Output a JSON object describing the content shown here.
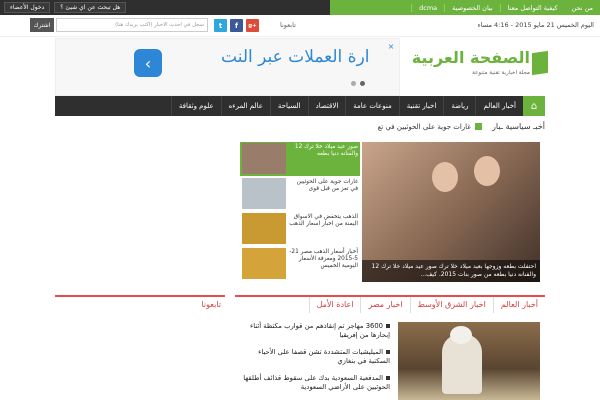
{
  "topbar": {
    "links": [
      "من نحن",
      "كيفية التواصل معنا",
      "بيان الخصوصية",
      "dcma"
    ],
    "search_question": "هل تبحث عن اي شيئ ؟",
    "login": "دخول الأعضاء"
  },
  "datestrip": {
    "date": "اليوم الخميس 21 مايو 2015 - 4:16 مساء",
    "follow_label": "تابعونا",
    "newsletter_placeholder": "سجل في احدث الاخبار (اكتب بريدك هنا)",
    "subscribe_label": "اشترك"
  },
  "social": {
    "twitter": "t",
    "facebook": "f",
    "googleplus": "g+"
  },
  "ad": {
    "text": "ارة العملات عبر النت",
    "close": "×",
    "next": "‹"
  },
  "logo": {
    "name": "الصفحة العربية",
    "tagline": "مجلة اخبارية تقنية متنوعة"
  },
  "nav": {
    "home_icon": "home-icon",
    "items": [
      "أخبار العالم",
      "رياضة",
      "اخبار تقنية",
      "منوعات عامة",
      "الاقتصاد",
      "السياحة",
      "عالم المرءه",
      "علوم وثقافة"
    ]
  },
  "ticker": {
    "title": "أخبـ سياسية ـبار",
    "text": "غارات جوية على الحوثيين في تع"
  },
  "featured": {
    "main_caption": "احتفلت بطعه وزوجها بعيد ميلاد خلا ترك صور عيد ميلاد خلا ترك 12 والفنانه دنيا بطعه من صور بنات 2015. كيف...",
    "items": [
      {
        "text": "صور عيد ميلاد خلا ترك 12 والفنانه دنيا بطعه"
      },
      {
        "text": "غارات جوية على الحوثيين في تعز من قبل قوى"
      },
      {
        "text": "الذهب يتخفض في الاسواق اليمنة من اخبار اسعار الذهب"
      },
      {
        "text": "أخبار أسعار الذهب مصر 21-5-2015 ومعرفة الأسعار اليومية الخميس"
      }
    ]
  },
  "sections": {
    "tabs": [
      "أخبار العالم",
      "اخبار الشرق الأوسط",
      "اخبار مصر",
      "اعادة الأمل"
    ],
    "follow_title": "تابعونا"
  },
  "news": [
    "3600 مهاجر تم إنقاذهم من قوارب مكتظة أثناء إبحارها من إفريقيا",
    "الميليشيات المتشددة تشن قصفا على الأحياء السكنية في بنغازي",
    "المدفعية السعودية بدك على سقوط قذائف أطلقها الحوثيين على الأراضي السعودية"
  ]
}
